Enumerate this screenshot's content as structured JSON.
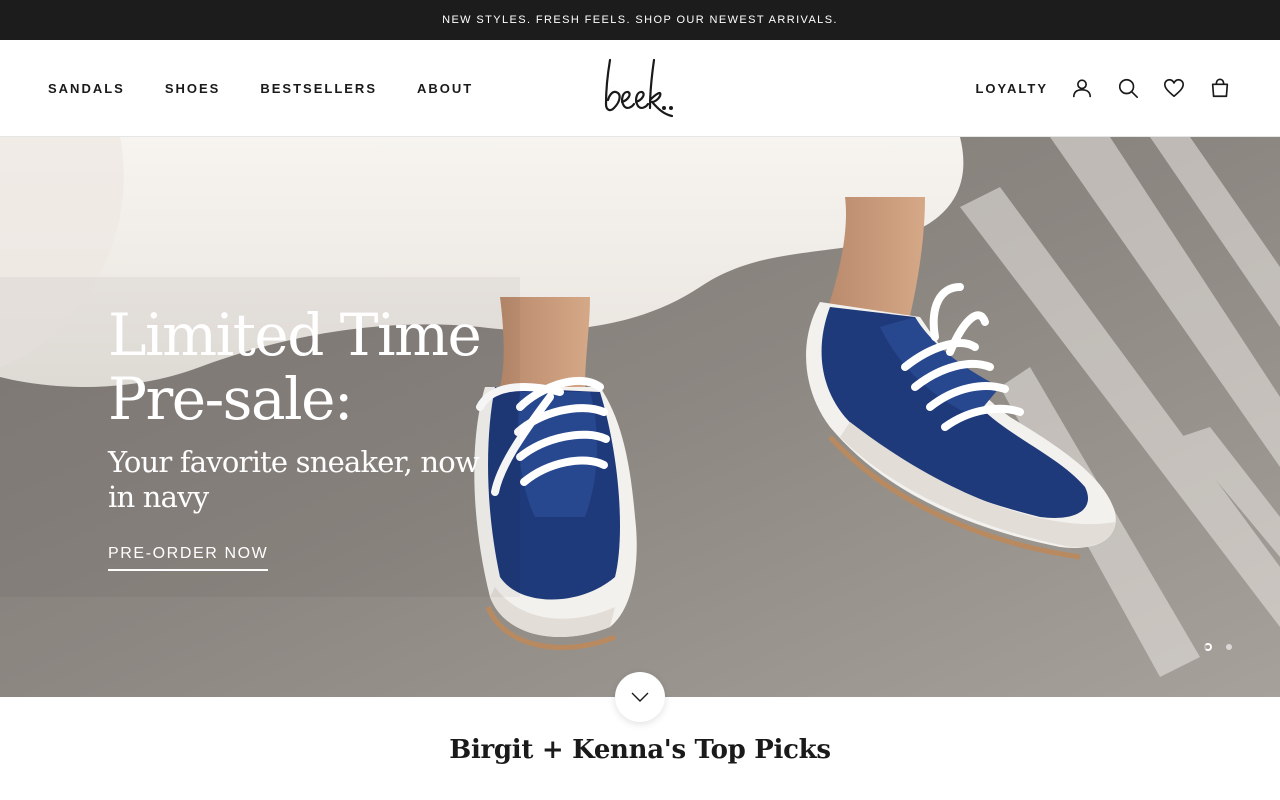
{
  "announcement": {
    "text": "NEW STYLES. FRESH FEELS. SHOP OUR NEWEST ARRIVALS."
  },
  "nav": {
    "left": [
      {
        "label": "SANDALS"
      },
      {
        "label": "SHOES"
      },
      {
        "label": "BESTSELLERS"
      },
      {
        "label": "ABOUT"
      }
    ],
    "logo": {
      "text": "beek.."
    },
    "right": {
      "loyalty_label": "LOYALTY",
      "icons": [
        "account-icon",
        "search-icon",
        "wishlist-heart-icon",
        "cart-bag-icon"
      ]
    }
  },
  "hero": {
    "title": "Limited Time Pre-sale:",
    "subtitle": "Your favorite sneaker, now in navy",
    "cta": "PRE-ORDER NOW",
    "slides": {
      "count": 2,
      "active": 1
    }
  },
  "scroll_button": {
    "icon": "chevron-down-icon"
  },
  "section": {
    "title": "Birgit + Kenna's Top Picks"
  },
  "colors": {
    "announcement_bg": "#1c1c1c",
    "sneaker_navy": "#1f3a7a",
    "text": "#1a1a1a"
  }
}
